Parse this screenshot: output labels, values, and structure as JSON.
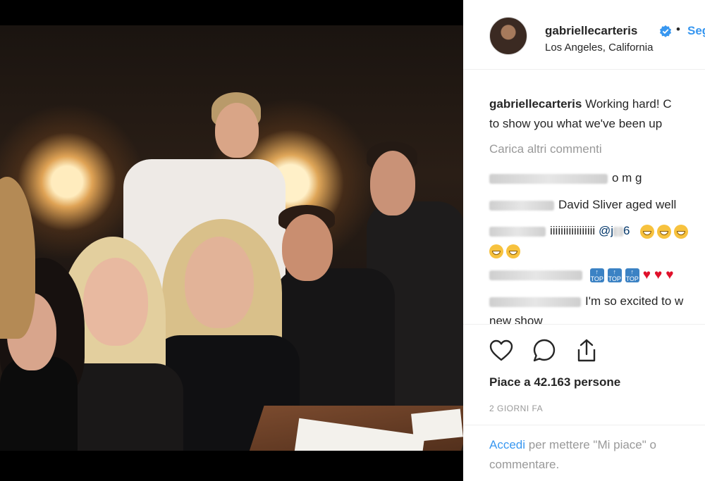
{
  "post": {
    "username": "gabriellecarteris",
    "separator": "•",
    "follow_label": "Seg",
    "location": "Los Angeles, California"
  },
  "caption": {
    "username": "gabriellecarteris",
    "line1": "Working hard! C",
    "line2": "to show you what we've been up"
  },
  "load_more": "Carica altri commenti",
  "comments": [
    {
      "text": "o m g"
    },
    {
      "text": "David Sliver aged well"
    },
    {
      "text": "iiiiiiiiiiiiiiiii",
      "mention": "@j",
      "mention_tail": "6"
    },
    {
      "text": ""
    },
    {
      "text": "I'm so excited to w",
      "text2": "new show"
    }
  ],
  "likes": "Piace a 42.163 persone",
  "timestamp": "2 GIORNI FA",
  "login": {
    "link": "Accedi",
    "rest_line1": "per mettere \"Mi piace\" o",
    "rest_line2": "commentare."
  },
  "colors": {
    "link": "#3897f0",
    "text": "#262626",
    "muted": "#999999",
    "verified": "#3897f0"
  },
  "icons": [
    "verified-badge-icon",
    "heart-icon",
    "comment-icon",
    "share-icon"
  ]
}
